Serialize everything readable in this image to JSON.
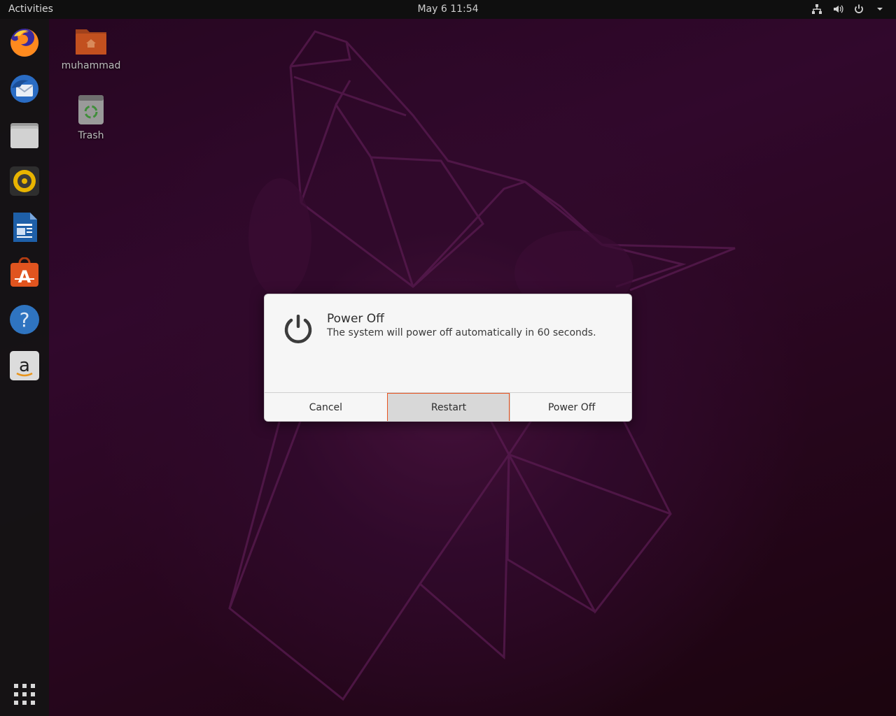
{
  "topbar": {
    "activities": "Activities",
    "clock": "May 6  11:54",
    "tray_icons": [
      "network-icon",
      "volume-icon",
      "power-icon",
      "menu-arrow-icon"
    ]
  },
  "dock": {
    "items": [
      {
        "name": "firefox",
        "icon": "firefox-icon"
      },
      {
        "name": "thunderbird",
        "icon": "thunderbird-icon"
      },
      {
        "name": "files",
        "icon": "files-icon"
      },
      {
        "name": "rhythmbox",
        "icon": "rhythmbox-icon"
      },
      {
        "name": "libreoffice-writer",
        "icon": "writer-icon"
      },
      {
        "name": "ubuntu-software",
        "icon": "software-icon"
      },
      {
        "name": "help",
        "icon": "help-icon"
      },
      {
        "name": "amazon",
        "icon": "amazon-icon"
      }
    ],
    "show_apps_icon": "app-grid-icon"
  },
  "desktop": {
    "icons": [
      {
        "label": "muhammad",
        "icon": "home-folder-icon"
      },
      {
        "label": "Trash",
        "icon": "trash-icon"
      }
    ]
  },
  "dialog": {
    "title": "Power Off",
    "message": "The system will power off automatically in 60 seconds.",
    "icon": "power-icon",
    "buttons": {
      "cancel": "Cancel",
      "restart": "Restart",
      "power_off": "Power Off"
    },
    "focused_button": "restart"
  },
  "colors": {
    "accent": "#e95420",
    "wallpaper_purple": "#4c0d44"
  }
}
